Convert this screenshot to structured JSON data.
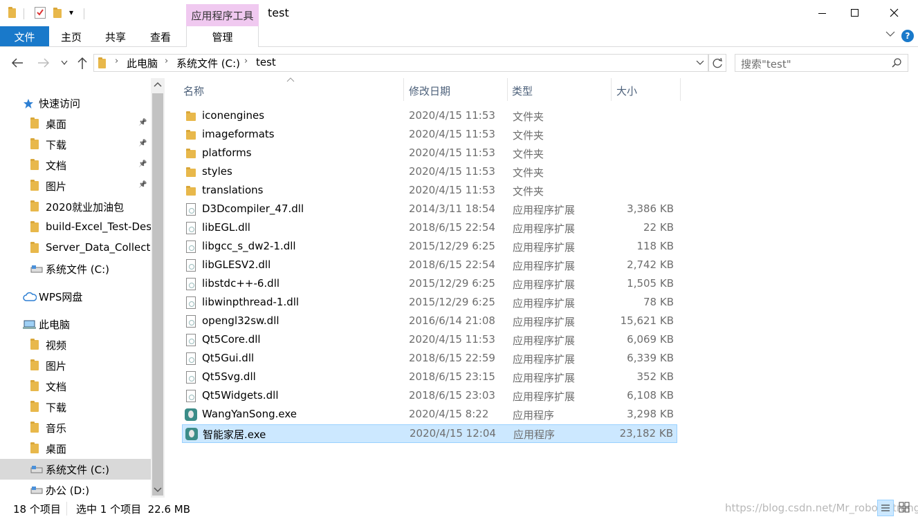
{
  "title_bar": {
    "contextual_tab": "应用程序工具",
    "window_title": "test",
    "quick_access_dropdown": "▾"
  },
  "ribbon": {
    "tabs": [
      "文件",
      "主页",
      "共享",
      "查看",
      "管理"
    ]
  },
  "address": {
    "crumbs": [
      "此电脑",
      "系统文件 (C:)",
      "test"
    ],
    "search_placeholder": "搜索\"test\""
  },
  "columns": {
    "name": "名称",
    "date": "修改日期",
    "type": "类型",
    "size": "大小"
  },
  "files": [
    {
      "name": "iconengines",
      "date": "2020/4/15 11:53",
      "type": "文件夹",
      "size": "",
      "icon": "folder-icon"
    },
    {
      "name": "imageformats",
      "date": "2020/4/15 11:53",
      "type": "文件夹",
      "size": "",
      "icon": "folder-icon"
    },
    {
      "name": "platforms",
      "date": "2020/4/15 11:53",
      "type": "文件夹",
      "size": "",
      "icon": "folder-icon"
    },
    {
      "name": "styles",
      "date": "2020/4/15 11:53",
      "type": "文件夹",
      "size": "",
      "icon": "folder-icon"
    },
    {
      "name": "translations",
      "date": "2020/4/15 11:53",
      "type": "文件夹",
      "size": "",
      "icon": "folder-icon"
    },
    {
      "name": "D3Dcompiler_47.dll",
      "date": "2014/3/11 18:54",
      "type": "应用程序扩展",
      "size": "3,386 KB",
      "icon": "dll-icon"
    },
    {
      "name": "libEGL.dll",
      "date": "2018/6/15 22:54",
      "type": "应用程序扩展",
      "size": "22 KB",
      "icon": "dll-icon"
    },
    {
      "name": "libgcc_s_dw2-1.dll",
      "date": "2015/12/29 6:25",
      "type": "应用程序扩展",
      "size": "118 KB",
      "icon": "dll-icon"
    },
    {
      "name": "libGLESV2.dll",
      "date": "2018/6/15 22:54",
      "type": "应用程序扩展",
      "size": "2,742 KB",
      "icon": "dll-icon"
    },
    {
      "name": "libstdc++-6.dll",
      "date": "2015/12/29 6:25",
      "type": "应用程序扩展",
      "size": "1,505 KB",
      "icon": "dll-icon"
    },
    {
      "name": "libwinpthread-1.dll",
      "date": "2015/12/29 6:25",
      "type": "应用程序扩展",
      "size": "78 KB",
      "icon": "dll-icon"
    },
    {
      "name": "opengl32sw.dll",
      "date": "2016/6/14 21:08",
      "type": "应用程序扩展",
      "size": "15,621 KB",
      "icon": "dll-icon"
    },
    {
      "name": "Qt5Core.dll",
      "date": "2020/4/15 11:53",
      "type": "应用程序扩展",
      "size": "6,069 KB",
      "icon": "dll-icon"
    },
    {
      "name": "Qt5Gui.dll",
      "date": "2018/6/15 22:59",
      "type": "应用程序扩展",
      "size": "6,339 KB",
      "icon": "dll-icon"
    },
    {
      "name": "Qt5Svg.dll",
      "date": "2018/6/15 23:15",
      "type": "应用程序扩展",
      "size": "352 KB",
      "icon": "dll-icon"
    },
    {
      "name": "Qt5Widgets.dll",
      "date": "2018/6/15 23:03",
      "type": "应用程序扩展",
      "size": "6,108 KB",
      "icon": "dll-icon"
    },
    {
      "name": "WangYanSong.exe",
      "date": "2020/4/15 8:22",
      "type": "应用程序",
      "size": "3,298 KB",
      "icon": "exe-icon"
    },
    {
      "name": "智能家居.exe",
      "date": "2020/4/15 12:04",
      "type": "应用程序",
      "size": "23,182 KB",
      "icon": "exe-icon",
      "selected": true
    }
  ],
  "sidebar": [
    {
      "label": "快速访问",
      "kind": "section",
      "icon": "star-icon"
    },
    {
      "label": "桌面",
      "kind": "item",
      "icon": "desktop-folder-icon",
      "pinned": true
    },
    {
      "label": "下载",
      "kind": "item",
      "icon": "download-folder-icon",
      "pinned": true
    },
    {
      "label": "文档",
      "kind": "item",
      "icon": "documents-folder-icon",
      "pinned": true
    },
    {
      "label": "图片",
      "kind": "item",
      "icon": "pictures-folder-icon",
      "pinned": true
    },
    {
      "label": "2020就业加油包",
      "kind": "item",
      "icon": "folder-icon"
    },
    {
      "label": "build-Excel_Test-Des",
      "kind": "item",
      "icon": "folder-icon"
    },
    {
      "label": "Server_Data_Collecti",
      "kind": "item",
      "icon": "folder-icon"
    },
    {
      "label": "系统文件 (C:)",
      "kind": "item",
      "icon": "drive-icon"
    },
    {
      "label": "WPS网盘",
      "kind": "section",
      "icon": "cloud-icon"
    },
    {
      "label": "此电脑",
      "kind": "section",
      "icon": "computer-icon"
    },
    {
      "label": "视频",
      "kind": "item",
      "icon": "videos-folder-icon"
    },
    {
      "label": "图片",
      "kind": "item",
      "icon": "pictures-folder-icon"
    },
    {
      "label": "文档",
      "kind": "item",
      "icon": "documents-folder-icon"
    },
    {
      "label": "下载",
      "kind": "item",
      "icon": "download-folder-icon"
    },
    {
      "label": "音乐",
      "kind": "item",
      "icon": "music-folder-icon"
    },
    {
      "label": "桌面",
      "kind": "item",
      "icon": "desktop-folder-icon"
    },
    {
      "label": "系统文件 (C:)",
      "kind": "item",
      "icon": "drive-icon",
      "selected": true
    },
    {
      "label": "办公 (D:)",
      "kind": "item",
      "icon": "drive-icon"
    }
  ],
  "status": {
    "count": "18 个项目",
    "selection": "选中 1 个项目  22.6 MB"
  },
  "watermark": "https://blog.csdn.net/Mr_robot_strange",
  "colors": {
    "accent": "#1979ca",
    "selection": "#cce8ff",
    "contextual_tab": "#f0c9f0"
  }
}
